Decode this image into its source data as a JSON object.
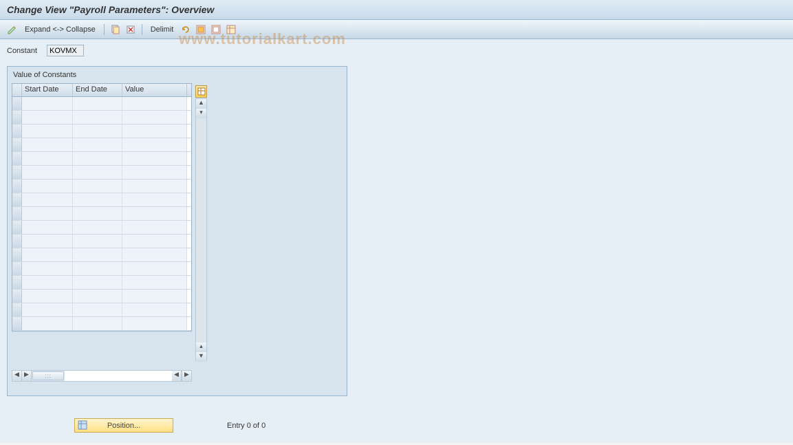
{
  "title": "Change View \"Payroll Parameters\": Overview",
  "toolbar": {
    "expand_collapse_label": "Expand <-> Collapse",
    "delimit_label": "Delimit"
  },
  "constant": {
    "label": "Constant",
    "value": "KOVMX"
  },
  "panel": {
    "title": "Value of Constants",
    "columns": {
      "start": "Start Date",
      "end": "End Date",
      "value": "Value"
    },
    "row_count": 17
  },
  "footer": {
    "position_label": "Position...",
    "entry_text": "Entry 0 of 0"
  },
  "watermark": "www.tutorialkart.com"
}
